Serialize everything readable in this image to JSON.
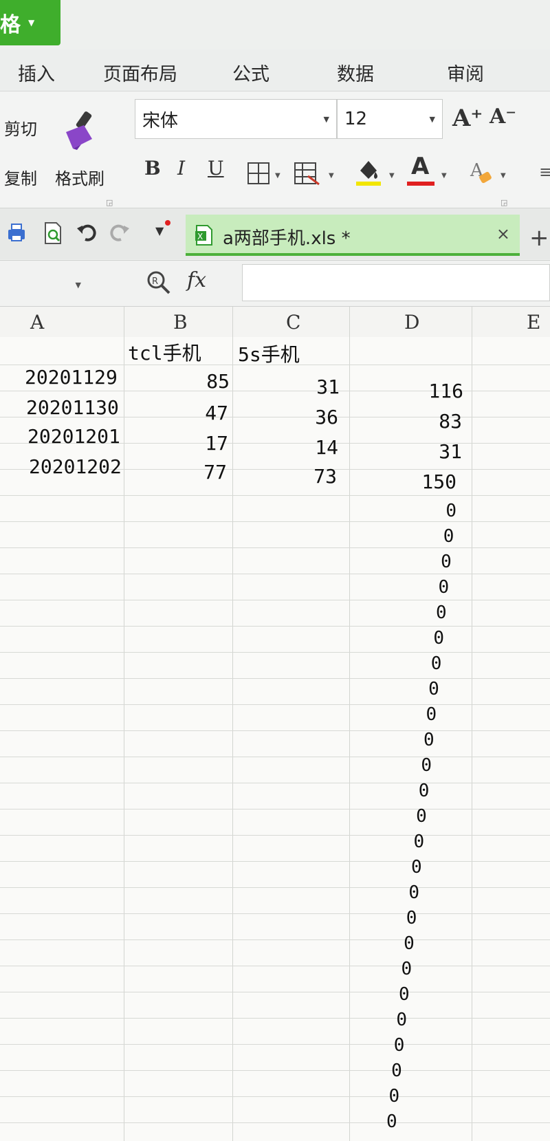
{
  "app": {
    "badge_text": "格"
  },
  "menu_tabs": [
    "插入",
    "页面布局",
    "公式",
    "数据",
    "审阅"
  ],
  "ribbon": {
    "cut_label": "剪切",
    "copy_label": "复制",
    "format_painter_label": "格式刷",
    "font_name": "宋体",
    "font_size": "12",
    "grow_font": "A⁺",
    "shrink_font": "A⁻",
    "bold": "B",
    "italic": "I",
    "underline": "U",
    "font_color_letter": "A",
    "colors": {
      "highlight": "#f2e600",
      "font_color": "#e02020",
      "brush": "#8a46c8",
      "accent": "#3fae2c"
    }
  },
  "document_tab": {
    "filename": "a两部手机.xls *",
    "close": "×",
    "new_tab": "+"
  },
  "formula_bar": {
    "fx": "fx",
    "content": ""
  },
  "sheet": {
    "columns": [
      "A",
      "B",
      "C",
      "D",
      "E"
    ],
    "header_row": {
      "B": "tcl手机",
      "C": "5s手机"
    },
    "rows": [
      {
        "A": "20201129",
        "B": "85",
        "C": "31",
        "D": "116"
      },
      {
        "A": "20201130",
        "B": "47",
        "C": "36",
        "D": "83"
      },
      {
        "A": "20201201",
        "B": "17",
        "C": "14",
        "D": "31"
      },
      {
        "A": "20201202",
        "B": "77",
        "C": "73",
        "D": "150"
      }
    ],
    "zero_value": "0"
  }
}
